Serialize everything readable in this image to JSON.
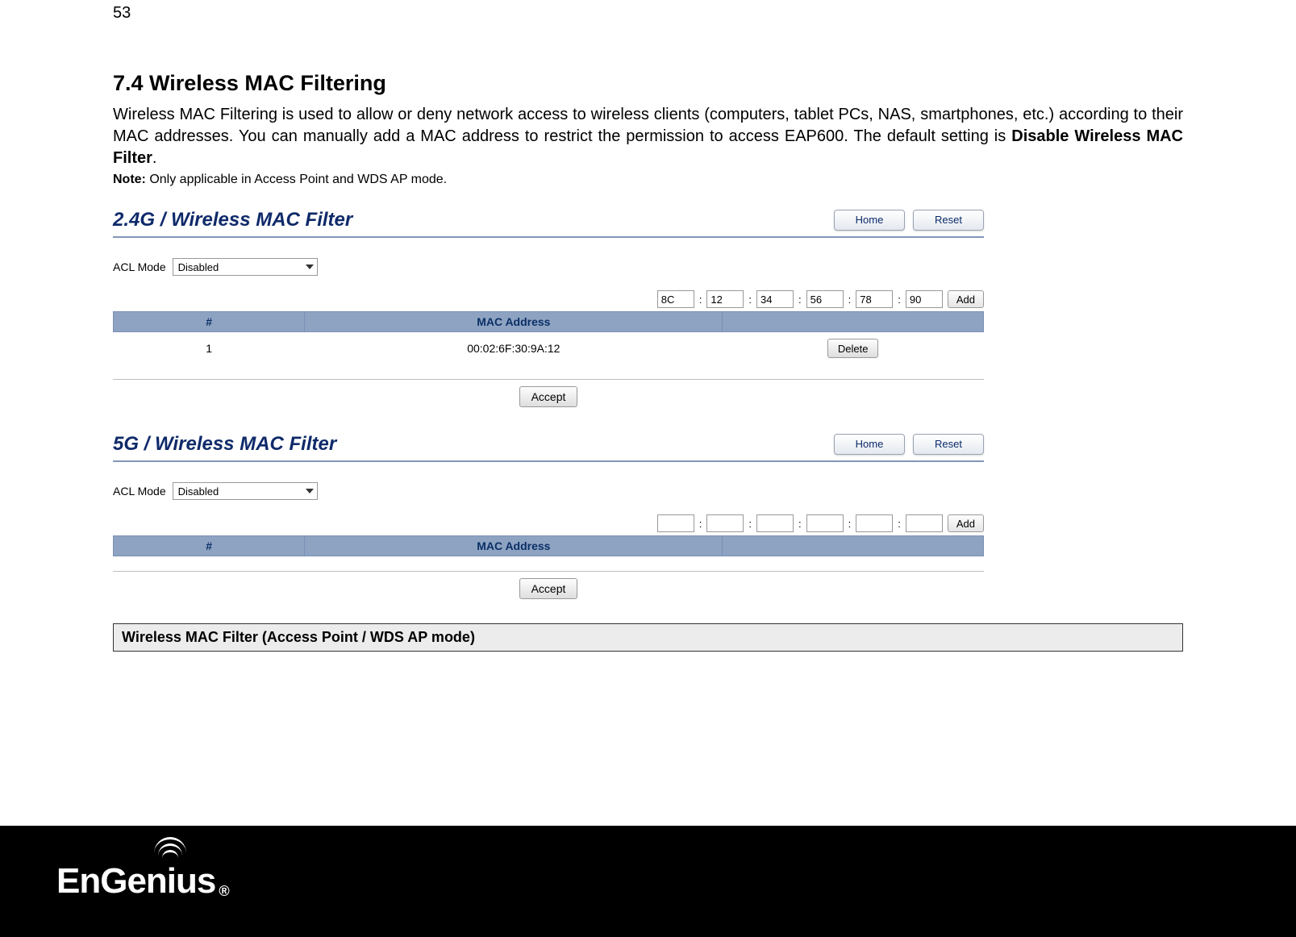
{
  "page_number": "53",
  "heading": "7.4   Wireless MAC Filtering",
  "body_paragraph_pre": "Wireless MAC Filtering is used to allow or deny network access to wireless clients (computers, tablet PCs, NAS, smartphones, etc.) according to their MAC addresses. You can manually add a MAC address to restrict the permission to access EAP600. The default setting is ",
  "body_paragraph_bold": "Disable Wireless MAC Filter",
  "body_paragraph_post": ".",
  "note_label": "Note:",
  "note_text": " Only applicable in Access Point and WDS AP mode.",
  "panel24": {
    "title": "2.4G / Wireless MAC Filter",
    "home": "Home",
    "reset": "Reset",
    "acl_label": "ACL Mode",
    "acl_value": "Disabled",
    "mac_octets": [
      "8C",
      "12",
      "34",
      "56",
      "78",
      "90"
    ],
    "sep": ":",
    "add": "Add",
    "th_num": "#",
    "th_mac": "MAC Address",
    "th_act": "",
    "rows": [
      {
        "n": "1",
        "mac": "00:02:6F:30:9A:12",
        "delete": "Delete"
      }
    ],
    "accept": "Accept"
  },
  "panel5": {
    "title": "5G / Wireless MAC Filter",
    "home": "Home",
    "reset": "Reset",
    "acl_label": "ACL Mode",
    "acl_value": "Disabled",
    "mac_octets": [
      "",
      "",
      "",
      "",
      "",
      ""
    ],
    "sep": ":",
    "add": "Add",
    "th_num": "#",
    "th_mac": "MAC Address",
    "th_act": "",
    "accept": "Accept"
  },
  "caption": "Wireless MAC Filter (Access Point / WDS AP mode)",
  "logo_text_pre": "EnGen",
  "logo_text_i": "i",
  "logo_text_post": "us",
  "logo_reg": "®"
}
